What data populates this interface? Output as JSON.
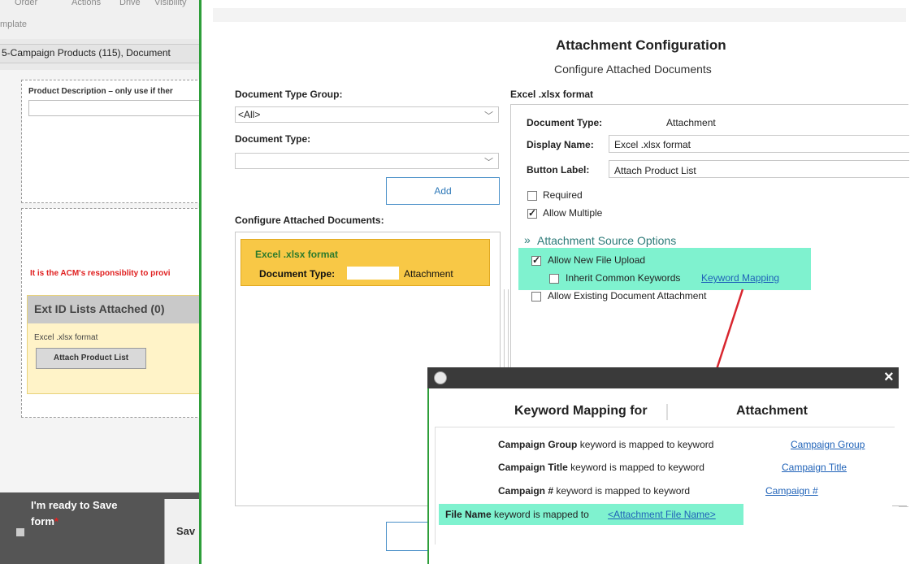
{
  "background_app": {
    "menu_items": [
      "Order",
      "Actions",
      "Drive",
      "Visibility"
    ],
    "template_label": "mplate",
    "breadcrumb": "5-Campaign Products (115), Document",
    "product_description_label": "Product Description – only use if ther",
    "warning_text": "It is the ACM's responsiblity to provi",
    "ext_id_title": "Ext ID Lists Attached (0)",
    "ext_id_format": "Excel .xlsx format",
    "attach_button": "Attach Product List",
    "ready_label": "I'm ready to Save form",
    "required_mark": "*",
    "save_button": "Sav"
  },
  "dialog": {
    "title": "Attachment Configuration",
    "subtitle": "Configure Attached Documents",
    "doc_type_group_label": "Document Type Group:",
    "doc_type_group_value": "<All>",
    "doc_type_label": "Document Type:",
    "doc_type_value": "",
    "add_button": "Add",
    "configure_label": "Configure Attached Documents:",
    "list_item": {
      "name": "Excel .xlsx format",
      "doc_type_label": "Document Type:",
      "doc_type_value": "Attachment"
    },
    "detail": {
      "header": "Excel .xlsx format",
      "doc_type_label": "Document Type:",
      "doc_type_value": "Attachment",
      "display_name_label": "Display Name:",
      "display_name_value": "Excel .xlsx format",
      "button_label_label": "Button Label:",
      "button_label_value": "Attach Product List",
      "required_label": "Required",
      "required_checked": false,
      "allow_multiple_label": "Allow Multiple",
      "allow_multiple_checked": true,
      "source_options_title": "Attachment Source Options",
      "allow_new_upload_label": "Allow New File Upload",
      "allow_new_upload_checked": true,
      "inherit_keywords_label": "Inherit Common Keywords",
      "inherit_keywords_checked": false,
      "keyword_mapping_link": "Keyword Mapping",
      "allow_existing_label": "Allow Existing Document Attachment",
      "allow_existing_checked": false
    }
  },
  "popup": {
    "title_prefix": "Keyword Mapping for",
    "title_suffix": "Attachment",
    "close_glyph": "×",
    "rows": [
      {
        "name": "Campaign Group",
        "text": "keyword is mapped to keyword",
        "link": "Campaign Group"
      },
      {
        "name": "Campaign Title",
        "text": "keyword is mapped to keyword",
        "link": "Campaign Title"
      },
      {
        "name": "Campaign #",
        "text": "keyword is mapped to keyword",
        "link": "Campaign #"
      }
    ],
    "file_row": {
      "name": "File Name",
      "text": "keyword is mapped to",
      "link": "<Attachment File Name>"
    }
  },
  "colors": {
    "highlight": "#7ff2cf",
    "selected_item": "#f8c846",
    "link": "#1f62b8",
    "arrow": "#d8262f",
    "accent_green": "#2e9e3a"
  },
  "icons": [
    "chevron-down-icon",
    "chevron-double-up-icon",
    "check-icon",
    "close-icon",
    "app-logo-icon",
    "red-arrow"
  ]
}
